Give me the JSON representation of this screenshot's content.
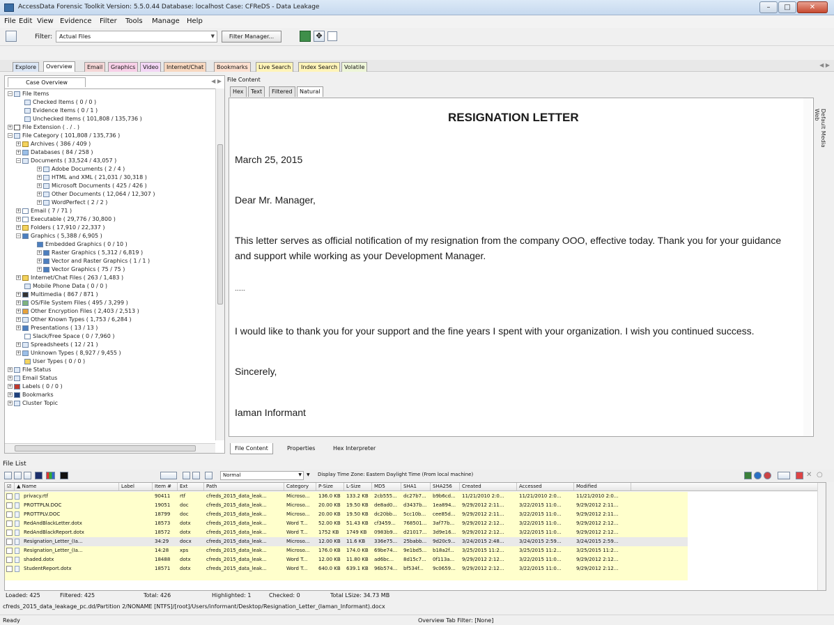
{
  "window": {
    "title": "AccessData Forensic Toolkit Version: 5.5.0.44 Database: localhost Case: CFReDS - Data Leakage"
  },
  "menu": [
    "File",
    "Edit",
    "View",
    "Evidence",
    "Filter",
    "Tools",
    "Manage",
    "Help"
  ],
  "filterbar": {
    "label": "Filter:",
    "value": "Actual Files",
    "manager_label": "Filter Manager..."
  },
  "tabs": [
    "Explore",
    "Overview",
    "Email",
    "Graphics",
    "Video",
    "Internet/Chat",
    "Bookmarks",
    "Live Search",
    "Index Search",
    "Volatile"
  ],
  "case_overview": {
    "tab_label": "Case Overview",
    "tree": [
      "File Items",
      "Checked Items ( 0 / 0 )",
      "Evidence Items ( 0 / 1 )",
      "Unchecked Items ( 101,808 / 135,736 )",
      "File Extension ( . / . )",
      "File Category ( 101,808 / 135,736 )",
      "Archives ( 386 / 409 )",
      "Databases ( 84 / 258 )",
      "Documents ( 33,524 / 43,057 )",
      "Adobe Documents ( 2 / 4 )",
      "HTML and XML ( 21,031 / 30,318 )",
      "Microsoft Documents ( 425 / 426 )",
      "Other Documents ( 12,064 / 12,307 )",
      "WordPerfect ( 2 / 2 )",
      "Email ( 7 / 71 )",
      "Executable ( 29,776 / 30,800 )",
      "Folders ( 17,910 / 22,337 )",
      "Graphics ( 5,388 / 6,905 )",
      "Embedded Graphics ( 0 / 10 )",
      "Raster Graphics ( 5,312 / 6,819 )",
      "Vector and Raster Graphics ( 1 / 1 )",
      "Vector Graphics ( 75 / 75 )",
      "Internet/Chat Files ( 263 / 1,483 )",
      "Mobile Phone Data ( 0 / 0 )",
      "Multimedia ( 867 / 871 )",
      "OS/File System Files ( 495 / 3,299 )",
      "Other Encryption Files ( 2,403 / 2,513 )",
      "Other Known Types ( 1,753 / 6,284 )",
      "Presentations ( 13 / 13 )",
      "Slack/Free Space ( 0 / 7,960 )",
      "Spreadsheets ( 12 / 21 )",
      "Unknown Types ( 8,927 / 9,455 )",
      "User Types ( 0 / 0 )",
      "File Status",
      "Email Status",
      "Labels ( 0 / 0 )",
      "Bookmarks",
      "Cluster Topic"
    ]
  },
  "file_content": {
    "title": "File Content",
    "subtabs": [
      "Hex",
      "Text",
      "Filtered",
      "Natural"
    ],
    "side_label": "Default Media Web",
    "document": {
      "heading": "RESIGNATION LETTER",
      "date": "March 25, 2015",
      "salutation": "Dear Mr. Manager,",
      "para1_line1": "This letter serves as official notification of my resignation from the company OOO, effective today. Thank you for your guidance",
      "para1_line2": "and support while working as your Development Manager.",
      "ellipsis": "......",
      "para2": "I would like to thank you for your support and the fine years I spent with your organization. I wish you continued success.",
      "closing": "Sincerely,",
      "signature": "Iaman Informant"
    },
    "bottom_tabs": [
      "File Content",
      "Properties",
      "Hex Interpreter"
    ]
  },
  "file_list": {
    "label": "File List",
    "view_select": "Normal",
    "timezone": "Display Time Zone: Eastern Daylight Time  (From local machine)",
    "columns": [
      "Name",
      "Label",
      "Item #",
      "Ext",
      "Path",
      "Category",
      "P-Size",
      "L-Size",
      "MD5",
      "SHA1",
      "SHA256",
      "Created",
      "Accessed",
      "Modified"
    ],
    "rows": [
      [
        "privacy.rtf",
        "",
        "90411",
        "rtf",
        "cfreds_2015_data_leak...",
        "Microso...",
        "136.0 KB",
        "133.2 KB",
        "2cb555...",
        "dc27b7...",
        "b9b6cd...",
        "11/21/2010 2:0...",
        "11/21/2010 2:0...",
        "11/21/2010 2:0..."
      ],
      [
        "PROTTPLN.DOC",
        "",
        "19051",
        "doc",
        "cfreds_2015_data_leak...",
        "Microso...",
        "20.00 KB",
        "19.50 KB",
        "de8ad0...",
        "d3437b...",
        "1ea894...",
        "9/29/2012 2:11...",
        "3/22/2015 11:0...",
        "9/29/2012 2:11..."
      ],
      [
        "PROTTPLV.DOC",
        "",
        "18799",
        "doc",
        "cfreds_2015_data_leak...",
        "Microso...",
        "20.00 KB",
        "19.50 KB",
        "dc20bb...",
        "5cc10b...",
        "cee85d...",
        "9/29/2012 2:11...",
        "3/22/2015 11:0...",
        "9/29/2012 2:11..."
      ],
      [
        "RedAndBlackLetter.dotx",
        "",
        "18573",
        "dotx",
        "cfreds_2015_data_leak...",
        "Word T...",
        "52.00 KB",
        "51.43 KB",
        "cf3459...",
        "768501...",
        "3af77b...",
        "9/29/2012 2:12...",
        "3/22/2015 11:0...",
        "9/29/2012 2:12..."
      ],
      [
        "RedAndBlackReport.dotx",
        "",
        "18572",
        "dotx",
        "cfreds_2015_data_leak...",
        "Word T...",
        "1752 KB",
        "1749 KB",
        "0983b9...",
        "d21017...",
        "3d9e16...",
        "9/29/2012 2:12...",
        "3/22/2015 11:0...",
        "9/29/2012 2:12..."
      ],
      [
        "Resignation_Letter_(Ia...",
        "",
        "34:29",
        "docx",
        "cfreds_2015_data_leak...",
        "Microso...",
        "12.00 KB",
        "11.6 KB",
        "336e75...",
        "25babb...",
        "9d20c9...",
        "3/24/2015 2:48...",
        "3/24/2015 2:59...",
        "3/24/2015 2:59..."
      ],
      [
        "Resignation_Letter_(Ia...",
        "",
        "14:28",
        "xps",
        "cfreds_2015_data_leak...",
        "Microso...",
        "176.0 KB",
        "174.0 KB",
        "69be74...",
        "9e1bd5...",
        "b18a2f...",
        "3/25/2015 11:2...",
        "3/25/2015 11:2...",
        "3/25/2015 11:2..."
      ],
      [
        "shaded.dotx",
        "",
        "18488",
        "dotx",
        "cfreds_2015_data_leak...",
        "Word T...",
        "12.00 KB",
        "11.80 KB",
        "ad6bc...",
        "8d15c7...",
        "0f113a...",
        "9/29/2012 2:12...",
        "3/22/2015 11:0...",
        "9/29/2012 2:12..."
      ],
      [
        "StudentReport.dotx",
        "",
        "18571",
        "dotx",
        "cfreds_2015_data_leak...",
        "Word T...",
        "640.0 KB",
        "639.1 KB",
        "96b574...",
        "bf534f...",
        "9c0659...",
        "9/29/2012 2:12...",
        "3/22/2015 11:0...",
        "9/29/2012 2:12..."
      ]
    ]
  },
  "status": {
    "loaded": "Loaded: 425",
    "filtered": "Filtered: 425",
    "total": "Total: 426",
    "highlighted": "Highlighted: 1",
    "checked": "Checked: 0",
    "total_lsize": "Total LSize: 34.73 MB",
    "path": "cfreds_2015_data_leakage_pc.dd/Partition 2/NONAME [NTFS]/[root]/Users/informant/Desktop/Resignation_Letter_(Iaman_Informant).docx",
    "ready": "Ready",
    "overview_filter": "Overview Tab Filter: [None]"
  },
  "colors": {
    "row_highlight": "#ffffcc",
    "tab_email": "#f5d6d6",
    "tab_graphics": "#f8d0e8",
    "tab_search": "#fff4b8"
  }
}
